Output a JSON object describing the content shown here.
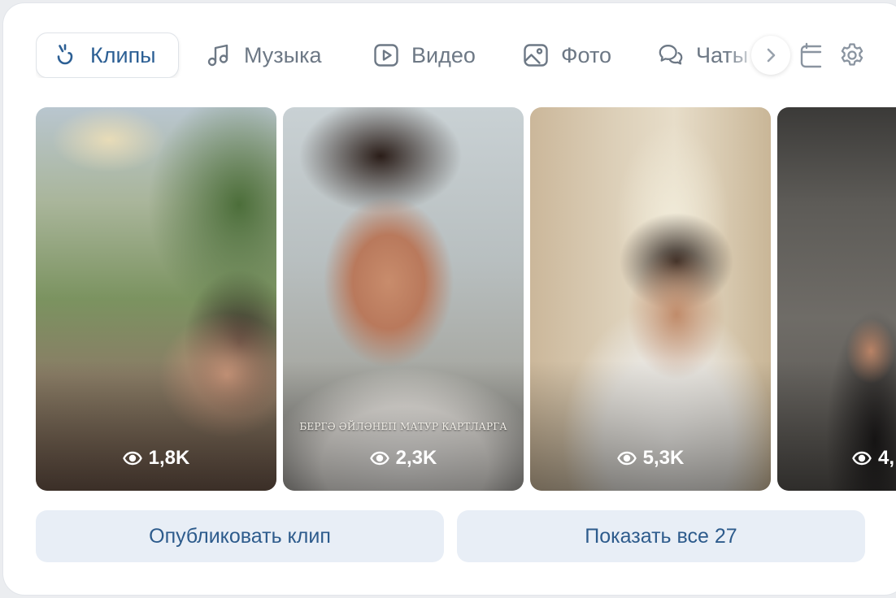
{
  "tabs": [
    {
      "label": "Клипы",
      "icon": "clips-icon",
      "active": true
    },
    {
      "label": "Музыка",
      "icon": "music-note-icon"
    },
    {
      "label": "Видео",
      "icon": "video-play-icon"
    },
    {
      "label": "Фото",
      "icon": "photo-icon"
    },
    {
      "label": "Чаты",
      "icon": "chat-bubbles-icon"
    }
  ],
  "toolbar": {
    "scroll_icon": "chevron-right-icon",
    "calendar_icon": "calendar-icon",
    "settings_icon": "gear-icon"
  },
  "clips": [
    {
      "views": "1,8K"
    },
    {
      "views": "2,3K",
      "caption": "БЕРГӘ ӘЙЛӘНЕП МАТУР КАРТЛАРГА"
    },
    {
      "views": "5,3K"
    },
    {
      "views": "4,"
    }
  ],
  "actions": {
    "publish_label": "Опубликовать клип",
    "show_all_label": "Показать все 27"
  },
  "colors": {
    "accent": "#2c5f94",
    "tab_inactive": "#6d7885",
    "button_bg": "#e8eef6",
    "button_text": "#2d5b8c"
  }
}
